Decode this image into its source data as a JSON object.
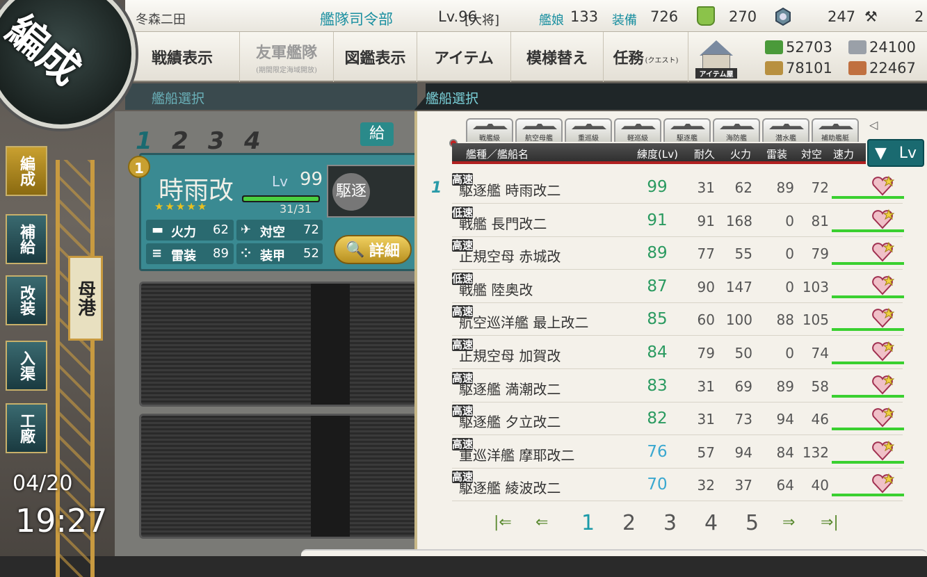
{
  "topbar": {
    "admiral_name": "冬森二田",
    "hq_label": "艦隊司令部",
    "hq_level": "Lv.96",
    "rank": "[大将]",
    "ships_label": "艦娘",
    "ships_count": "133",
    "equip_label": "装備",
    "equip_count": "726",
    "buckets": "270",
    "screws": "247",
    "devmats": "2"
  },
  "menu": {
    "record": "戦績表示",
    "friend_fleet": "友軍艦隊",
    "friend_fleet_sub": "(期間限定海域開放)",
    "encyclopedia": "図鑑表示",
    "items": "アイテム",
    "furniture": "模様替え",
    "quests": "任務",
    "quests_sub": "(クエスト)",
    "item_shop": "アイテム屋"
  },
  "resources": {
    "fuel": "52703",
    "steel": "24100",
    "ammo": "78101",
    "bauxite": "22467"
  },
  "headers": {
    "left": "艦船選択",
    "right": "艦船選択"
  },
  "circle_title": "編成",
  "side_nav": {
    "organize": "編成",
    "supply": "補給",
    "remodel": "改装",
    "repair": "入渠",
    "arsenal": "工廠",
    "port": "母港"
  },
  "clock": {
    "date": "04/20",
    "time": "19:27"
  },
  "fleet": {
    "tabs": [
      "1",
      "2",
      "3",
      "4"
    ],
    "supply_badge": "給",
    "flagship_no": "1",
    "ship_name": "時雨改",
    "lv_label": "Lv",
    "lv": "99",
    "stars": "★★★★★",
    "hp": "31/31",
    "hp_fraction": 1.0,
    "firepower_label": "火力",
    "firepower": "62",
    "aa_label": "対空",
    "aa": "72",
    "torpedo_label": "雷装",
    "torpedo": "89",
    "armor_label": "装甲",
    "armor": "52",
    "detail_label": "詳細",
    "ship_type_badge": "駆逐"
  },
  "type_tabs": [
    "戦艦級",
    "航空母艦",
    "重巡級",
    "軽巡級",
    "駆逐艦",
    "海防艦",
    "潜水艦",
    "補助艦艇"
  ],
  "columns": {
    "name": "艦種／艦船名",
    "level": "練度(Lv)",
    "hp": "耐久",
    "firepower": "火力",
    "torpedo": "雷装",
    "aa": "対空",
    "speed": "速力"
  },
  "sort": {
    "label": "Lv"
  },
  "ships": [
    {
      "name": "駆逐艦 時雨改二",
      "lv": "99",
      "hp": "31",
      "fp": "62",
      "tp": "89",
      "aa": "72",
      "speed": "高速",
      "lv_color": "#2a9a60"
    },
    {
      "name": "戦艦 長門改二",
      "lv": "91",
      "hp": "91",
      "fp": "168",
      "tp": "0",
      "aa": "81",
      "speed": "低速",
      "lv_color": "#2a9a60"
    },
    {
      "name": "正規空母 赤城改",
      "lv": "89",
      "hp": "77",
      "fp": "55",
      "tp": "0",
      "aa": "79",
      "speed": "高速",
      "lv_color": "#2a9a60"
    },
    {
      "name": "戦艦 陸奥改",
      "lv": "87",
      "hp": "90",
      "fp": "147",
      "tp": "0",
      "aa": "103",
      "speed": "低速",
      "lv_color": "#2a9a60"
    },
    {
      "name": "航空巡洋艦 最上改二",
      "lv": "85",
      "hp": "60",
      "fp": "100",
      "tp": "88",
      "aa": "105",
      "speed": "高速",
      "lv_color": "#2a9a60"
    },
    {
      "name": "正規空母 加賀改",
      "lv": "84",
      "hp": "79",
      "fp": "50",
      "tp": "0",
      "aa": "74",
      "speed": "高速",
      "lv_color": "#2a9a60"
    },
    {
      "name": "駆逐艦 満潮改二",
      "lv": "83",
      "hp": "31",
      "fp": "69",
      "tp": "89",
      "aa": "58",
      "speed": "高速",
      "lv_color": "#2a9a60"
    },
    {
      "name": "駆逐艦 夕立改二",
      "lv": "82",
      "hp": "31",
      "fp": "73",
      "tp": "94",
      "aa": "46",
      "speed": "高速",
      "lv_color": "#2a9a60"
    },
    {
      "name": "重巡洋艦 摩耶改二",
      "lv": "76",
      "hp": "57",
      "fp": "94",
      "tp": "84",
      "aa": "132",
      "speed": "高速",
      "lv_color": "#3aa8d0"
    },
    {
      "name": "駆逐艦 綾波改二",
      "lv": "70",
      "hp": "32",
      "fp": "37",
      "tp": "64",
      "aa": "40",
      "speed": "高速",
      "lv_color": "#3aa8d0"
    }
  ],
  "fleet_marker": "1",
  "pager": {
    "pages": [
      "1",
      "2",
      "3",
      "4",
      "5"
    ],
    "current": "1"
  },
  "colors": {
    "accent": "#1a8fa0",
    "header_bg": "#1f2628",
    "panel_bg": "#f4f1ea"
  }
}
